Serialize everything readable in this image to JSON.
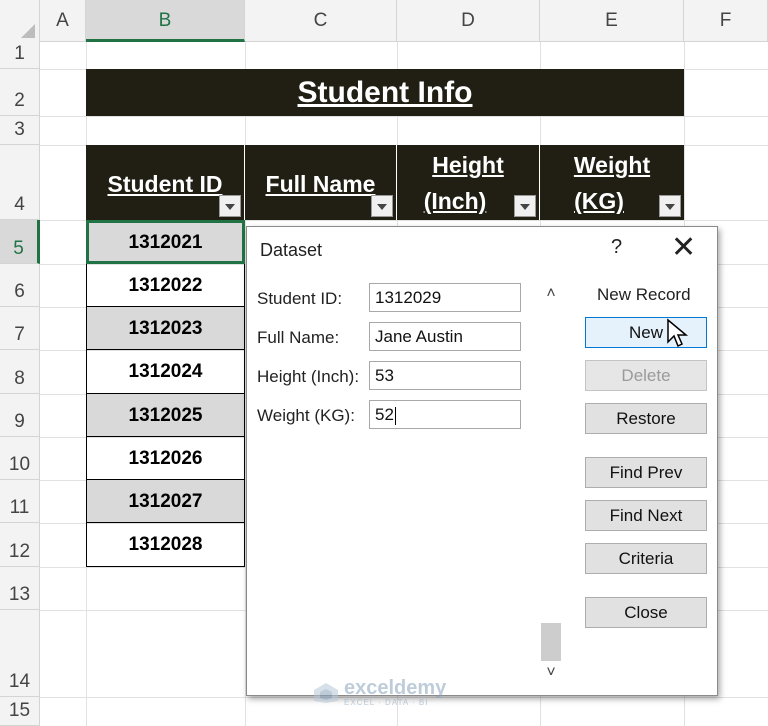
{
  "columns": [
    "A",
    "B",
    "C",
    "D",
    "E",
    "F"
  ],
  "rows": [
    "1",
    "2",
    "3",
    "4",
    "5",
    "6",
    "7",
    "8",
    "9",
    "10",
    "11",
    "12",
    "13",
    "14",
    "15"
  ],
  "title": "Student Info",
  "headers": {
    "student_id": "Student ID",
    "full_name": "Full Name",
    "height_line1": "Height",
    "height_line2": "(Inch)",
    "weight_line1": "Weight",
    "weight_line2": "(KG)"
  },
  "student_ids": [
    "1312021",
    "1312022",
    "1312023",
    "1312024",
    "1312025",
    "1312026",
    "1312027",
    "1312028"
  ],
  "dialog": {
    "title": "Dataset",
    "help": "?",
    "close": "✕",
    "fields": {
      "student_id_label": "Student ID:",
      "student_id_value": "1312029",
      "full_name_label": "Full Name:",
      "full_name_value": "Jane Austin",
      "height_label": "Height (Inch):",
      "height_value": "53",
      "weight_label": "Weight (KG):",
      "weight_value": "52"
    },
    "record_status": "New Record",
    "buttons": {
      "new": "New",
      "delete": "Delete",
      "restore": "Restore",
      "find_prev": "Find Prev",
      "find_next": "Find Next",
      "criteria": "Criteria",
      "close": "Close"
    },
    "scroll_up": "˄",
    "scroll_down": "˅"
  },
  "watermark": {
    "name": "exceldemy",
    "tagline": "EXCEL · DATA · BI"
  },
  "colors": {
    "dark_header": "#211f14",
    "selection_green": "#217346",
    "gray_fill": "#d9d9d9"
  }
}
